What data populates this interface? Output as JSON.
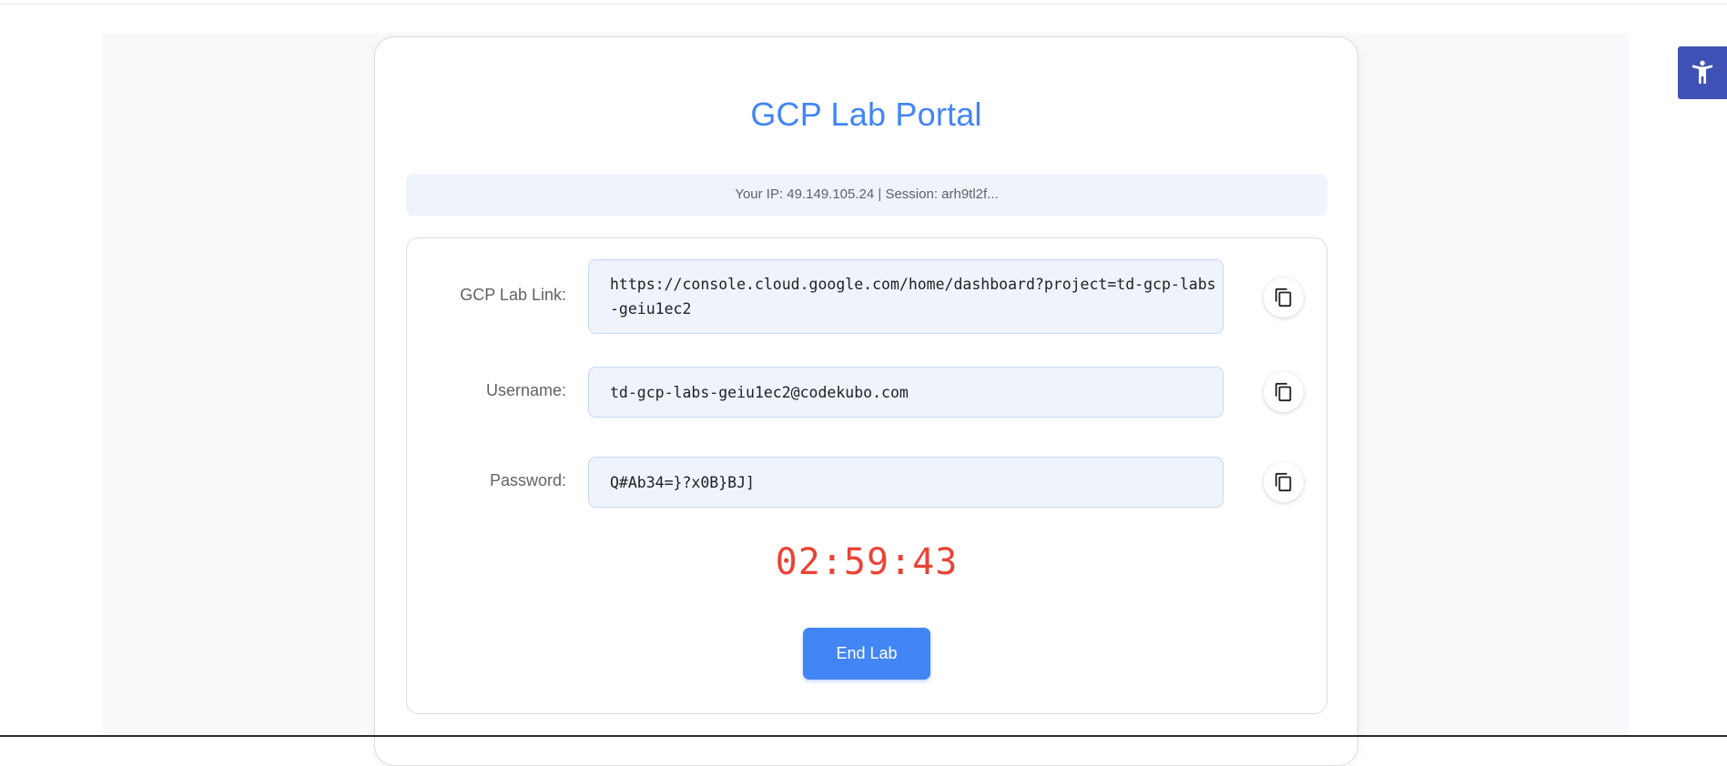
{
  "app": {
    "title": "GCP Lab Portal",
    "info_line": "Your IP: 49.149.105.24 | Session: arh9tl2f..."
  },
  "fields": [
    {
      "label": "GCP Lab Link:",
      "value": "https://console.cloud.google.com/home/dashboard?project=td-gcp-labs-geiu1ec2",
      "copy_icon": "copy-icon"
    },
    {
      "label": "Username:",
      "value": "td-gcp-labs-geiu1ec2@codekubo.com",
      "copy_icon": "copy-icon"
    },
    {
      "label": "Password:",
      "value": "Q#Ab34=}?x0B}BJ]",
      "copy_icon": "copy-icon"
    }
  ],
  "timer": "02:59:43",
  "actions": {
    "end_lab_label": "End Lab"
  },
  "colors": {
    "accent": "#4285f4",
    "timer": "#ea4335",
    "accessibility": "#3f51b5"
  },
  "icons": {
    "accessibility": "accessibility-icon"
  }
}
